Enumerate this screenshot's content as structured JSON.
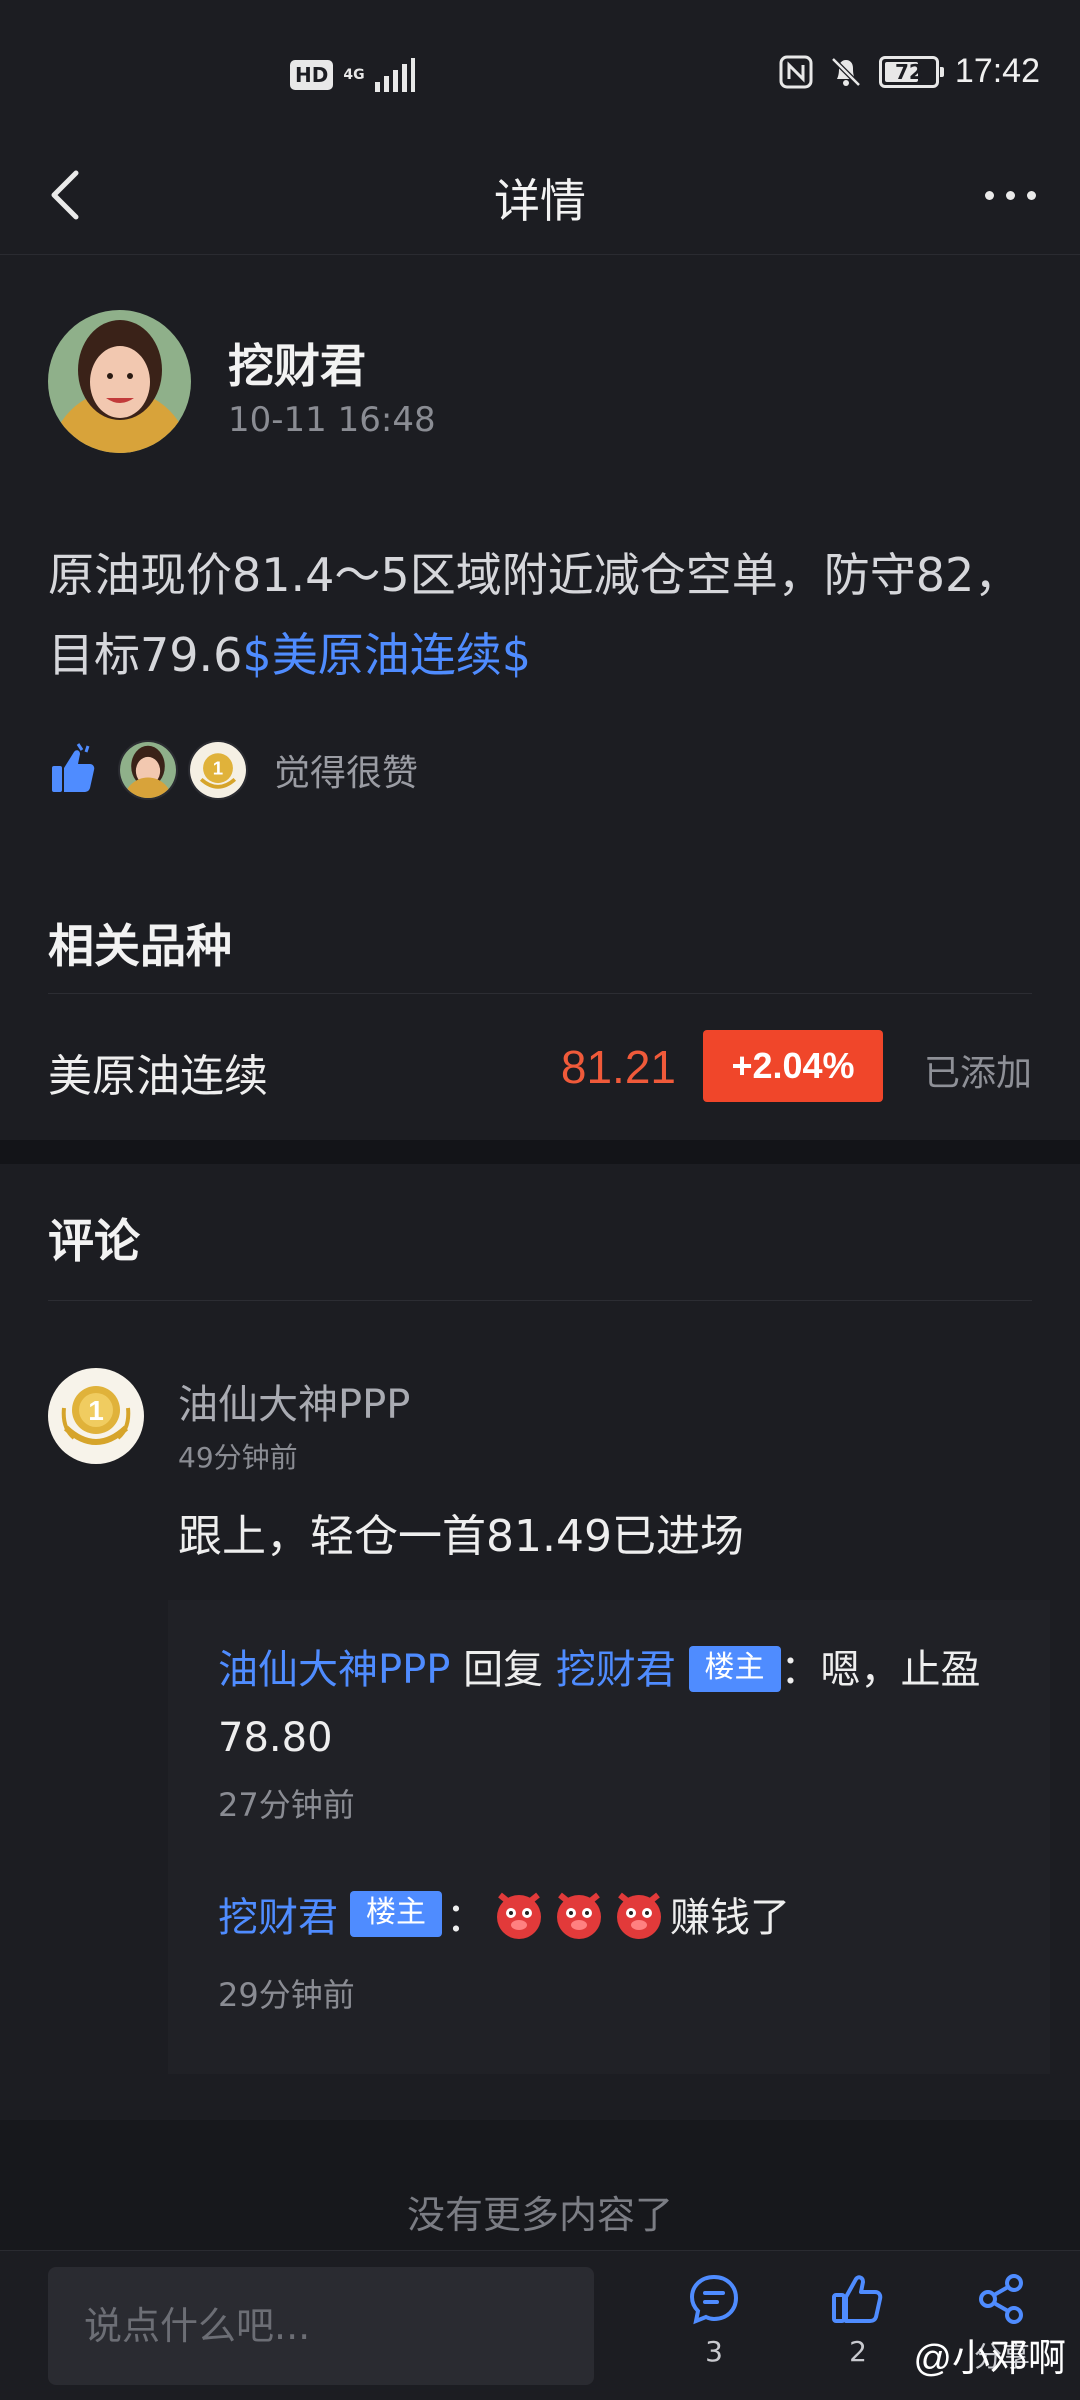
{
  "status_bar": {
    "hd": "HD",
    "network": "4G",
    "battery": "72",
    "battery_level": 0.72,
    "time": "17:42"
  },
  "nav": {
    "title": "详情"
  },
  "post": {
    "author": "挖财君",
    "time": "10-11 16:48",
    "text_part1": "原油现价81.4～5区域附近减仓空单，防守82，目标79.6",
    "text_link": "$美原油连续$",
    "likes_label": "觉得很赞"
  },
  "related": {
    "title": "相关品种",
    "name": "美原油连续",
    "price": "81.21",
    "change": "+2.04%",
    "status": "已添加"
  },
  "comments": {
    "title": "评论",
    "items": [
      {
        "user": "油仙大神PPP",
        "time": "49分钟前",
        "text": "跟上，轻仓一首81.49已进场",
        "replies": [
          {
            "from": "油仙大神PPP",
            "verb": "回复",
            "to": "挖财君",
            "to_badge": "楼主",
            "text": "：嗯，止盈78.80",
            "time": "27分钟前"
          },
          {
            "from": "挖财君",
            "from_badge": "楼主",
            "colon": "：",
            "text": "赚钱了",
            "time": "29分钟前"
          }
        ]
      }
    ],
    "no_more": "没有更多内容了"
  },
  "bottom_bar": {
    "input_placeholder": "说点什么吧...",
    "comment_count": "3",
    "like_count": "2",
    "share_label": "分享",
    "watermark": "@小邓啊"
  },
  "colors": {
    "accent_blue": "#4f8cff",
    "price_red": "#f05a3a",
    "change_bg": "#f0462a",
    "background": "#1c1d22"
  }
}
